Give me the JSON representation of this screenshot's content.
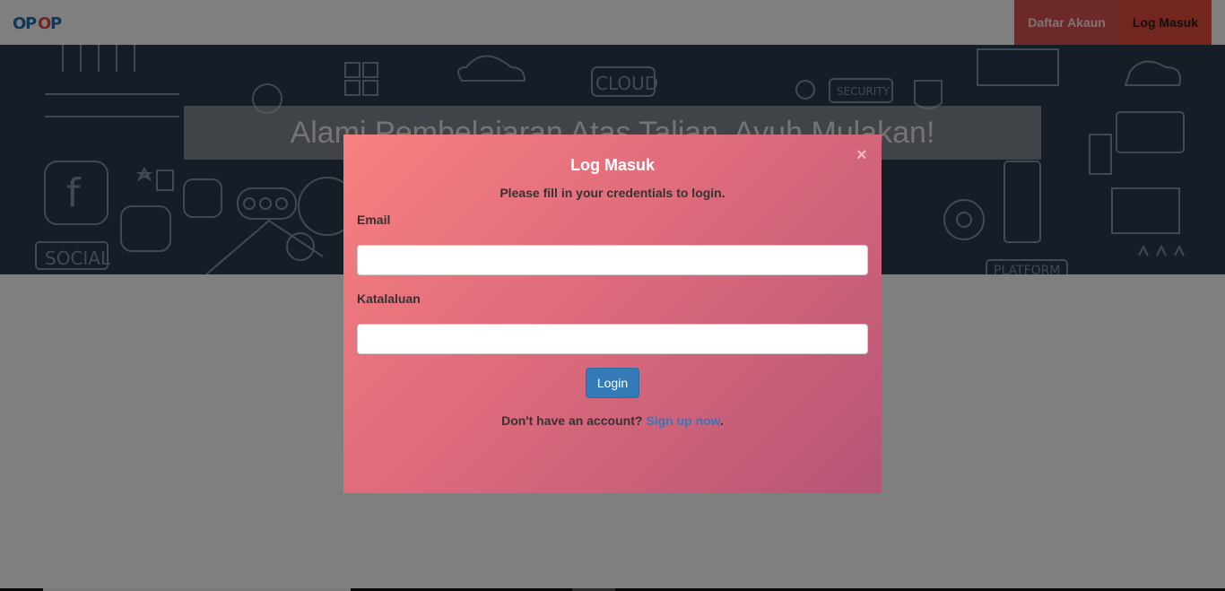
{
  "navbar": {
    "logo_text": "OPOP",
    "links": [
      {
        "label": "Daftar Akaun"
      },
      {
        "label": "Log Masuk"
      }
    ]
  },
  "hero": {
    "title": "Alami Pembelajaran Atas Talian. Ayuh Mulakan!",
    "doodles": [
      "CLOUD",
      "SOCIAL",
      "SECURITY",
      "PLATFORM"
    ]
  },
  "modal": {
    "title": "Log Masuk",
    "subtitle": "Please fill in your credentials to login.",
    "close_icon": "×",
    "email_label": "Email",
    "email_value": "",
    "password_label": "Katalaluan",
    "password_value": "",
    "login_button": "Login",
    "signup_prompt": "Don't have an account?",
    "signup_link": "Sign up now",
    "signup_suffix": "."
  },
  "colors": {
    "modal_gradient_start": "#f78080",
    "modal_gradient_end": "#b65576",
    "primary": "#337ab7",
    "nav_accent": "#e74c3c"
  }
}
